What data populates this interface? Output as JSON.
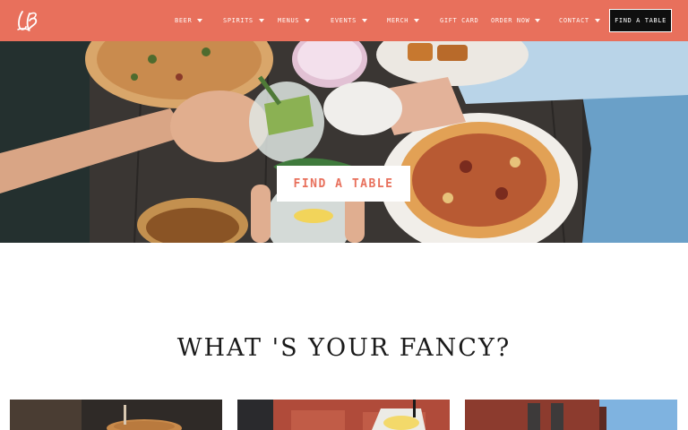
{
  "brand": {
    "logo_text": "LB",
    "accent_color": "#e8705c"
  },
  "nav": {
    "items": [
      {
        "label": "BEER",
        "has_dropdown": true
      },
      {
        "label": "SPIRITS",
        "has_dropdown": true
      },
      {
        "label": "MENUS",
        "has_dropdown": true
      },
      {
        "label": "EVENTS",
        "has_dropdown": true
      },
      {
        "label": "MERCH",
        "has_dropdown": true
      },
      {
        "label": "GIFT CARD",
        "has_dropdown": false
      },
      {
        "label": "ORDER NOW",
        "has_dropdown": true
      },
      {
        "label": "CONTACT",
        "has_dropdown": true
      }
    ],
    "cta_label": "FIND A TABLE"
  },
  "hero": {
    "button_label": "FIND A TABLE"
  },
  "section": {
    "title": "WHAT 'S YOUR FANCY?"
  }
}
